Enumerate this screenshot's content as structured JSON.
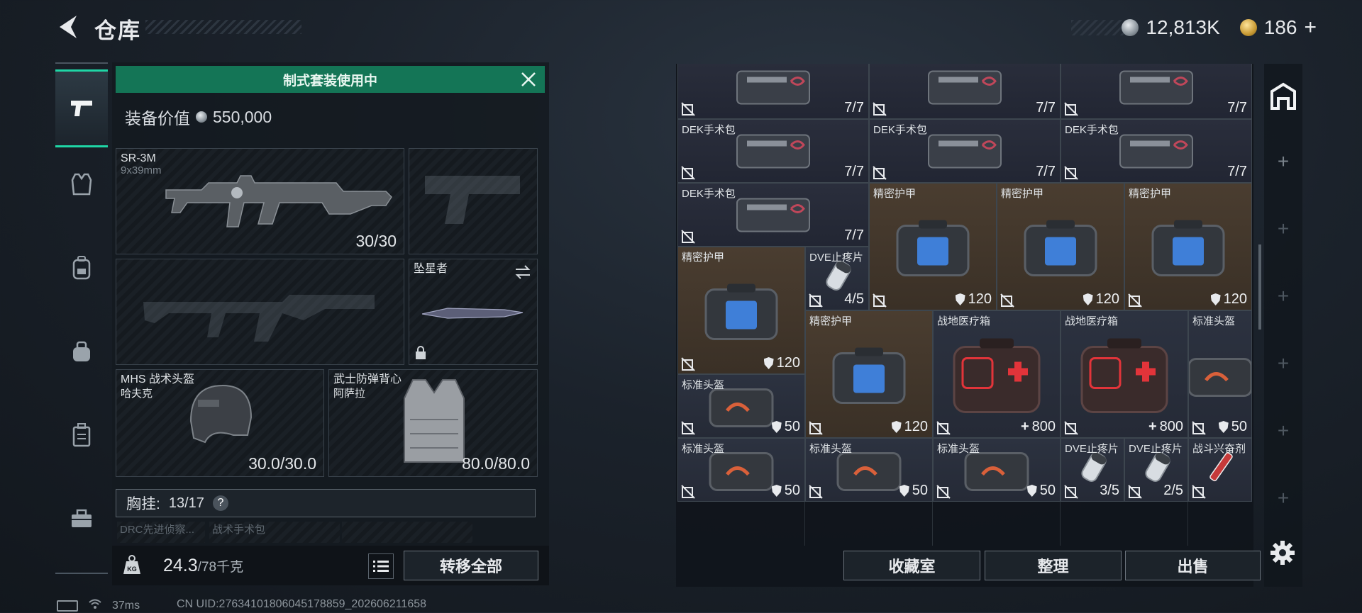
{
  "header": {
    "title": "仓库",
    "coins": "12,813K",
    "premium": "186"
  },
  "loadout": {
    "kit_banner": "制式套装使用中",
    "equipment_value_label": "装备价值",
    "equipment_value": "550,000",
    "primary": {
      "name": "SR-3M",
      "ammo": "9x39mm",
      "mag": "30/30"
    },
    "melee": {
      "name": "坠星者"
    },
    "helmet": {
      "name": "MHS 战术头盔",
      "sub": "哈夫克",
      "durability": "30.0/30.0"
    },
    "vest": {
      "name": "武士防弹背心",
      "sub": "阿萨拉",
      "durability": "80.0/80.0"
    },
    "chest_rig_label": "胸挂:",
    "chest_rig_value": "13/17",
    "chest_items": [
      "DRC先进侦察...",
      "战术手术包"
    ],
    "weight": "24.3",
    "weight_max": "/78千克",
    "transfer_all": "转移全部"
  },
  "status": {
    "ping": "37ms",
    "uid": "CN UID:2763410180604517885​9_202606211658"
  },
  "storage": {
    "buttons": [
      "收藏室",
      "整理",
      "出售"
    ],
    "items": [
      {
        "name": "",
        "count": "7/7",
        "kind": "kit"
      },
      {
        "name": "",
        "count": "7/7",
        "kind": "kit"
      },
      {
        "name": "",
        "count": "7/7",
        "kind": "kit"
      },
      {
        "name": "DEK手术包",
        "count": "7/7",
        "kind": "kit"
      },
      {
        "name": "DEK手术包",
        "count": "7/7",
        "kind": "kit"
      },
      {
        "name": "DEK手术包",
        "count": "7/7",
        "kind": "kit"
      },
      {
        "name": "DEK手术包",
        "count": "7/7",
        "kind": "kit"
      },
      {
        "name": "精密护甲",
        "count": "120",
        "kind": "armor"
      },
      {
        "name": "精密护甲",
        "count": "120",
        "kind": "armor"
      },
      {
        "name": "精密护甲",
        "count": "120",
        "kind": "armor"
      },
      {
        "name": "精密护甲",
        "count": "120",
        "kind": "armor"
      },
      {
        "name": "DVE止疼片",
        "count": "4/5",
        "kind": "pill"
      },
      {
        "name": "精密护甲",
        "count": "120",
        "kind": "armor"
      },
      {
        "name": "战地医疗箱",
        "count": "800",
        "kind": "medbox"
      },
      {
        "name": "战地医疗箱",
        "count": "800",
        "kind": "medbox"
      },
      {
        "name": "标准头盔",
        "count": "50",
        "kind": "helmet"
      },
      {
        "name": "标准头盔",
        "count": "50",
        "kind": "helmet"
      },
      {
        "name": "标准头盔",
        "count": "50",
        "kind": "helmet"
      },
      {
        "name": "标准头盔",
        "count": "50",
        "kind": "helmet"
      },
      {
        "name": "标准头盔",
        "count": "50",
        "kind": "helmet"
      },
      {
        "name": "DVE止疼片",
        "count": "3/5",
        "kind": "pill"
      },
      {
        "name": "DVE止疼片",
        "count": "2/5",
        "kind": "pill"
      },
      {
        "name": "战斗兴奋剂",
        "count": "",
        "kind": "stim"
      }
    ]
  },
  "colors": {
    "accent": "#1fd6a6",
    "banner": "#147556"
  }
}
